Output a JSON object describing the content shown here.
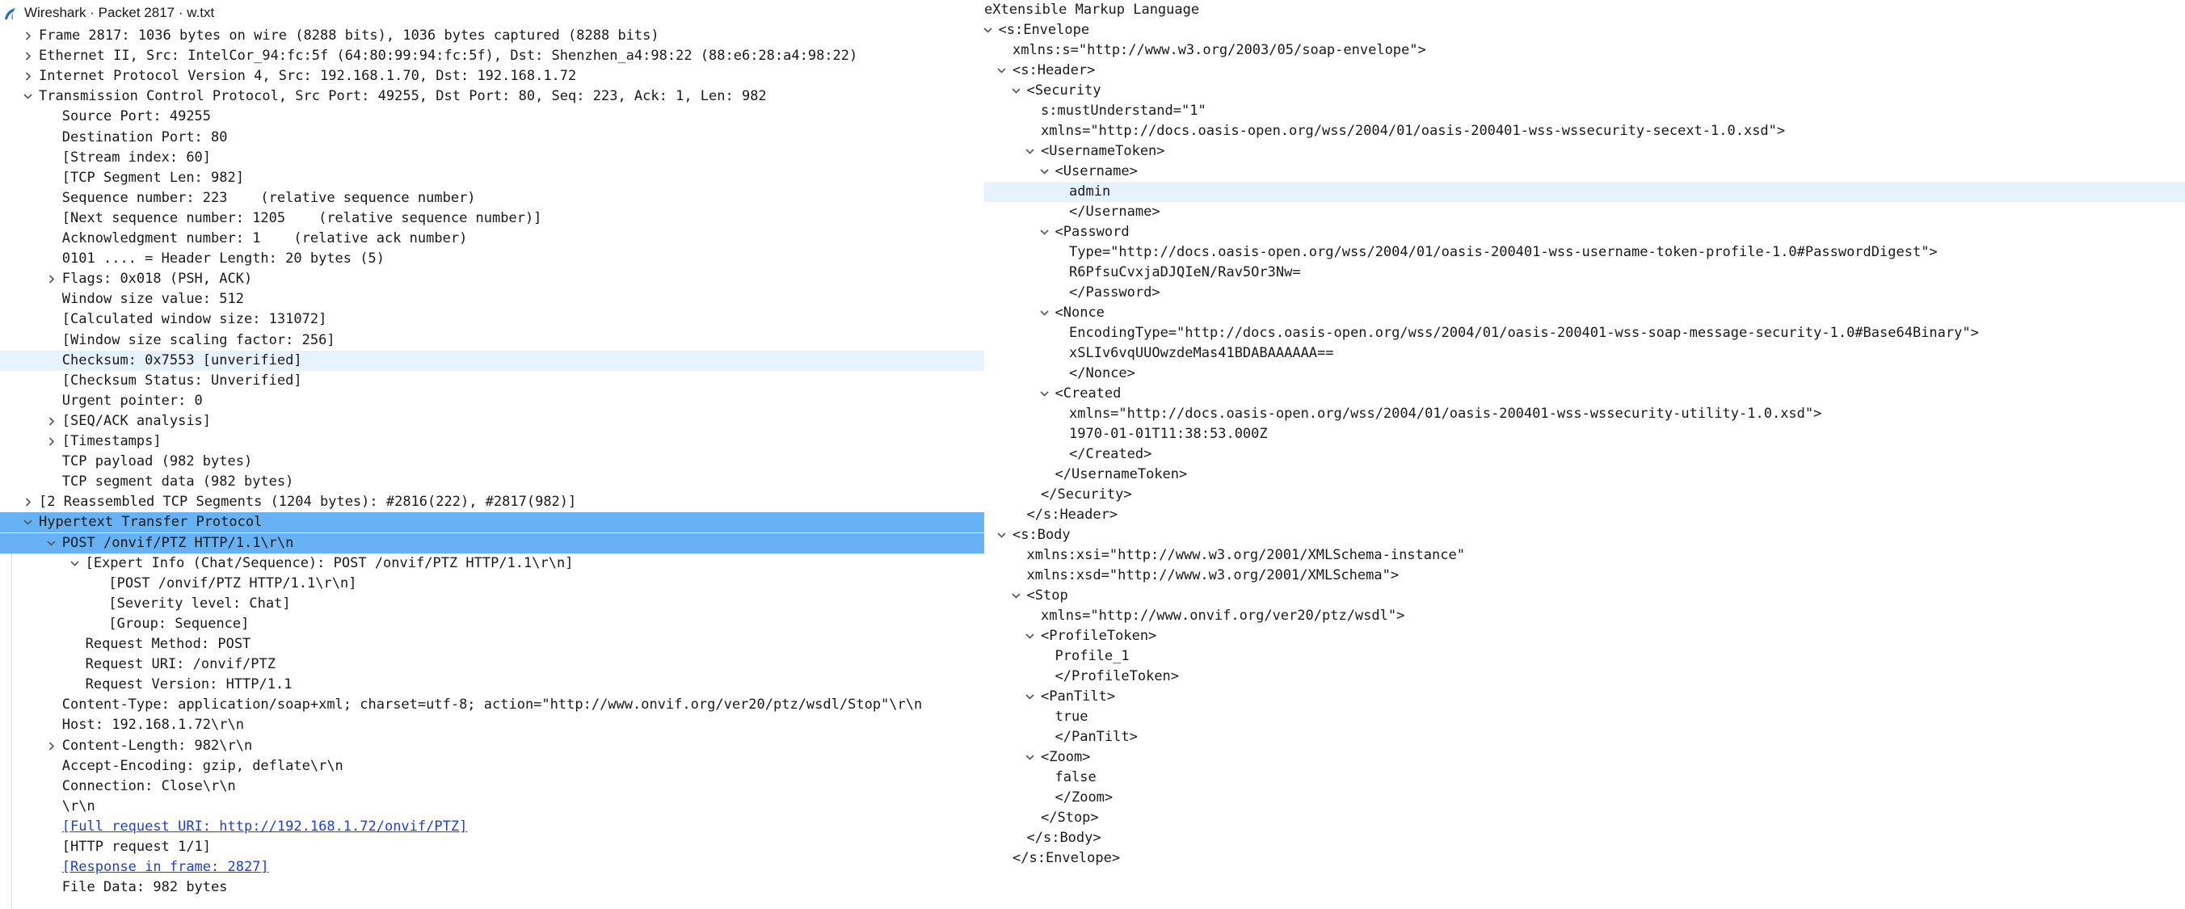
{
  "window": {
    "title": "Wireshark · Packet 2817 · w.txt"
  },
  "tree_left": [
    {
      "text": "Frame 2817: 1036 bytes on wire (8288 bits), 1036 bytes captured (8288 bits)",
      "level": 0,
      "toggle": "collapsed"
    },
    {
      "text": "Ethernet II, Src: IntelCor_94:fc:5f (64:80:99:94:fc:5f), Dst: Shenzhen_a4:98:22 (88:e6:28:a4:98:22)",
      "level": 0,
      "toggle": "collapsed"
    },
    {
      "text": "Internet Protocol Version 4, Src: 192.168.1.70, Dst: 192.168.1.72",
      "level": 0,
      "toggle": "collapsed"
    },
    {
      "text": "Transmission Control Protocol, Src Port: 49255, Dst Port: 80, Seq: 223, Ack: 1, Len: 982",
      "level": 0,
      "toggle": "expanded"
    },
    {
      "text": "Source Port: 49255",
      "level": 1,
      "toggle": "none"
    },
    {
      "text": "Destination Port: 80",
      "level": 1,
      "toggle": "none"
    },
    {
      "text": "[Stream index: 60]",
      "level": 1,
      "toggle": "none"
    },
    {
      "text": "[TCP Segment Len: 982]",
      "level": 1,
      "toggle": "none"
    },
    {
      "text": "Sequence number: 223    (relative sequence number)",
      "level": 1,
      "toggle": "none"
    },
    {
      "text": "[Next sequence number: 1205    (relative sequence number)]",
      "level": 1,
      "toggle": "none"
    },
    {
      "text": "Acknowledgment number: 1    (relative ack number)",
      "level": 1,
      "toggle": "none"
    },
    {
      "text": "0101 .... = Header Length: 20 bytes (5)",
      "level": 1,
      "toggle": "none"
    },
    {
      "text": "Flags: 0x018 (PSH, ACK)",
      "level": 1,
      "toggle": "collapsed"
    },
    {
      "text": "Window size value: 512",
      "level": 1,
      "toggle": "none"
    },
    {
      "text": "[Calculated window size: 131072]",
      "level": 1,
      "toggle": "none"
    },
    {
      "text": "[Window size scaling factor: 256]",
      "level": 1,
      "toggle": "none"
    },
    {
      "text": "Checksum: 0x7553 [unverified]",
      "level": 1,
      "toggle": "none",
      "highlight": "light"
    },
    {
      "text": "[Checksum Status: Unverified]",
      "level": 1,
      "toggle": "none"
    },
    {
      "text": "Urgent pointer: 0",
      "level": 1,
      "toggle": "none"
    },
    {
      "text": "[SEQ/ACK analysis]",
      "level": 1,
      "toggle": "collapsed"
    },
    {
      "text": "[Timestamps]",
      "level": 1,
      "toggle": "collapsed"
    },
    {
      "text": "TCP payload (982 bytes)",
      "level": 1,
      "toggle": "none"
    },
    {
      "text": "TCP segment data (982 bytes)",
      "level": 1,
      "toggle": "none"
    },
    {
      "text": "[2 Reassembled TCP Segments (1204 bytes): #2816(222), #2817(982)]",
      "level": 0,
      "toggle": "collapsed"
    },
    {
      "text": "Hypertext Transfer Protocol",
      "level": 0,
      "toggle": "expanded",
      "highlight": "strong"
    },
    {
      "text": "POST /onvif/PTZ HTTP/1.1\\r\\n",
      "level": 1,
      "toggle": "expanded",
      "highlight": "strong"
    },
    {
      "text": "[Expert Info (Chat/Sequence): POST /onvif/PTZ HTTP/1.1\\r\\n]",
      "level": 2,
      "toggle": "expanded"
    },
    {
      "text": "[POST /onvif/PTZ HTTP/1.1\\r\\n]",
      "level": 3,
      "toggle": "none"
    },
    {
      "text": "[Severity level: Chat]",
      "level": 3,
      "toggle": "none"
    },
    {
      "text": "[Group: Sequence]",
      "level": 3,
      "toggle": "none"
    },
    {
      "text": "Request Method: POST",
      "level": 2,
      "toggle": "none"
    },
    {
      "text": "Request URI: /onvif/PTZ",
      "level": 2,
      "toggle": "none"
    },
    {
      "text": "Request Version: HTTP/1.1",
      "level": 2,
      "toggle": "none"
    },
    {
      "text": "Content-Type: application/soap+xml; charset=utf-8; action=\"http://www.onvif.org/ver20/ptz/wsdl/Stop\"\\r\\n",
      "level": 1,
      "toggle": "none"
    },
    {
      "text": "Host: 192.168.1.72\\r\\n",
      "level": 1,
      "toggle": "none"
    },
    {
      "text": "Content-Length: 982\\r\\n",
      "level": 1,
      "toggle": "collapsed"
    },
    {
      "text": "Accept-Encoding: gzip, deflate\\r\\n",
      "level": 1,
      "toggle": "none"
    },
    {
      "text": "Connection: Close\\r\\n",
      "level": 1,
      "toggle": "none"
    },
    {
      "text": "\\r\\n",
      "level": 1,
      "toggle": "none"
    },
    {
      "text": "[Full request URI: http://192.168.1.72/onvif/PTZ]",
      "level": 1,
      "toggle": "none",
      "link": true
    },
    {
      "text": "[HTTP request 1/1]",
      "level": 1,
      "toggle": "none"
    },
    {
      "text": "[Response in frame: 2827]",
      "level": 1,
      "toggle": "none",
      "link": true
    },
    {
      "text": "File Data: 982 bytes",
      "level": 1,
      "toggle": "none"
    }
  ],
  "tree_right": [
    {
      "text": "eXtensible Markup Language",
      "level": 0,
      "toggle": "expanded"
    },
    {
      "text": "<s:Envelope",
      "level": 1,
      "toggle": "expanded"
    },
    {
      "text": "xmlns:s=\"http://www.w3.org/2003/05/soap-envelope\">",
      "level": 2,
      "toggle": "none"
    },
    {
      "text": "<s:Header>",
      "level": 2,
      "toggle": "expanded"
    },
    {
      "text": "<Security",
      "level": 3,
      "toggle": "expanded"
    },
    {
      "text": "s:mustUnderstand=\"1\"",
      "level": 4,
      "toggle": "none"
    },
    {
      "text": "xmlns=\"http://docs.oasis-open.org/wss/2004/01/oasis-200401-wss-wssecurity-secext-1.0.xsd\">",
      "level": 4,
      "toggle": "none"
    },
    {
      "text": "<UsernameToken>",
      "level": 4,
      "toggle": "expanded"
    },
    {
      "text": "<Username>",
      "level": 5,
      "toggle": "expanded"
    },
    {
      "text": "admin",
      "level": 6,
      "toggle": "none",
      "highlight": "light"
    },
    {
      "text": "</Username>",
      "level": 6,
      "toggle": "none"
    },
    {
      "text": "<Password",
      "level": 5,
      "toggle": "expanded"
    },
    {
      "text": "Type=\"http://docs.oasis-open.org/wss/2004/01/oasis-200401-wss-username-token-profile-1.0#PasswordDigest\">",
      "level": 6,
      "toggle": "none"
    },
    {
      "text": "R6PfsuCvxjaDJQIeN/Rav5Or3Nw=",
      "level": 6,
      "toggle": "none"
    },
    {
      "text": "</Password>",
      "level": 6,
      "toggle": "none"
    },
    {
      "text": "<Nonce",
      "level": 5,
      "toggle": "expanded"
    },
    {
      "text": "EncodingType=\"http://docs.oasis-open.org/wss/2004/01/oasis-200401-wss-soap-message-security-1.0#Base64Binary\">",
      "level": 6,
      "toggle": "none"
    },
    {
      "text": "xSLIv6vqUUOwzdeMas41BDABAAAAAA==",
      "level": 6,
      "toggle": "none"
    },
    {
      "text": "</Nonce>",
      "level": 6,
      "toggle": "none"
    },
    {
      "text": "<Created",
      "level": 5,
      "toggle": "expanded"
    },
    {
      "text": "xmlns=\"http://docs.oasis-open.org/wss/2004/01/oasis-200401-wss-wssecurity-utility-1.0.xsd\">",
      "level": 6,
      "toggle": "none"
    },
    {
      "text": "1970-01-01T11:38:53.000Z",
      "level": 6,
      "toggle": "none"
    },
    {
      "text": "</Created>",
      "level": 6,
      "toggle": "none"
    },
    {
      "text": "</UsernameToken>",
      "level": 5,
      "toggle": "none"
    },
    {
      "text": "</Security>",
      "level": 4,
      "toggle": "none"
    },
    {
      "text": "</s:Header>",
      "level": 3,
      "toggle": "none"
    },
    {
      "text": "<s:Body",
      "level": 2,
      "toggle": "expanded"
    },
    {
      "text": "xmlns:xsi=\"http://www.w3.org/2001/XMLSchema-instance\"",
      "level": 3,
      "toggle": "none"
    },
    {
      "text": "xmlns:xsd=\"http://www.w3.org/2001/XMLSchema\">",
      "level": 3,
      "toggle": "none"
    },
    {
      "text": "<Stop",
      "level": 3,
      "toggle": "expanded"
    },
    {
      "text": "xmlns=\"http://www.onvif.org/ver20/ptz/wsdl\">",
      "level": 4,
      "toggle": "none"
    },
    {
      "text": "<ProfileToken>",
      "level": 4,
      "toggle": "expanded"
    },
    {
      "text": "Profile_1",
      "level": 5,
      "toggle": "none"
    },
    {
      "text": "</ProfileToken>",
      "level": 5,
      "toggle": "none"
    },
    {
      "text": "<PanTilt>",
      "level": 4,
      "toggle": "expanded"
    },
    {
      "text": "true",
      "level": 5,
      "toggle": "none"
    },
    {
      "text": "</PanTilt>",
      "level": 5,
      "toggle": "none"
    },
    {
      "text": "<Zoom>",
      "level": 4,
      "toggle": "expanded"
    },
    {
      "text": "false",
      "level": 5,
      "toggle": "none"
    },
    {
      "text": "</Zoom>",
      "level": 5,
      "toggle": "none"
    },
    {
      "text": "</Stop>",
      "level": 4,
      "toggle": "none"
    },
    {
      "text": "</s:Body>",
      "level": 3,
      "toggle": "none"
    },
    {
      "text": "</s:Envelope>",
      "level": 2,
      "toggle": "none"
    }
  ],
  "colors": {
    "highlight_light": "#e6f2fc",
    "highlight_strong": "#66b2f5",
    "link": "#1f3fd6",
    "text": "#1a1a1a"
  },
  "icons": {
    "app": "wireshark-fin-icon",
    "expanded": "chevron-down-icon",
    "collapsed": "chevron-right-icon"
  }
}
